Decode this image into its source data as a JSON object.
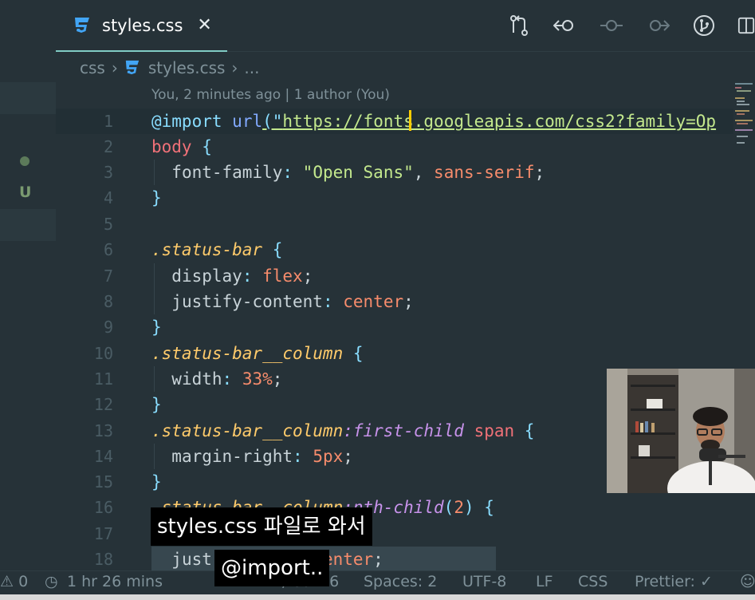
{
  "tab": {
    "title": "styles.css",
    "close": "✕"
  },
  "toolbar": {
    "icons": [
      "git-compare-icon",
      "go-back-icon",
      "commit-icon",
      "go-forward-icon",
      "source-control-icon",
      "split-editor-icon"
    ]
  },
  "breadcrumb": {
    "folder": "css",
    "file": "styles.css",
    "more": "..."
  },
  "blame": "You, 2 minutes ago | 1 author (You)",
  "sidebar": {
    "badge": "U"
  },
  "code_lines": [
    {
      "n": "1"
    },
    {
      "n": "2"
    },
    {
      "n": "3"
    },
    {
      "n": "4"
    },
    {
      "n": "5"
    },
    {
      "n": "6"
    },
    {
      "n": "7"
    },
    {
      "n": "8"
    },
    {
      "n": "9"
    },
    {
      "n": "10"
    },
    {
      "n": "11"
    },
    {
      "n": "12"
    },
    {
      "n": "13"
    },
    {
      "n": "14"
    },
    {
      "n": "15"
    },
    {
      "n": "16"
    },
    {
      "n": "17"
    },
    {
      "n": "18"
    }
  ],
  "code": {
    "l1": {
      "at": "@import",
      "fn": "url",
      "p1": "(\"",
      "url": "https://fonts.googleapis.com/css2?family=Op"
    },
    "l2": {
      "sel": "body",
      "brace": " {"
    },
    "l3": {
      "prop": "font-family",
      "colon": ": ",
      "v1": "\"Open Sans\"",
      "comma": ", ",
      "v2": "sans-serif",
      "semi": ";"
    },
    "l4": {
      "brace": "}"
    },
    "l6": {
      "sel": ".status-bar",
      "brace": " {"
    },
    "l7": {
      "prop": "display",
      "colon": ": ",
      "val": "flex",
      "semi": ";"
    },
    "l8": {
      "prop": "justify-content",
      "colon": ": ",
      "val": "center",
      "semi": ";"
    },
    "l9": {
      "brace": "}"
    },
    "l10": {
      "sel": ".status-bar__column",
      "brace": " {"
    },
    "l11": {
      "prop": "width",
      "colon": ": ",
      "val": "33%",
      "semi": ";"
    },
    "l12": {
      "brace": "}"
    },
    "l13": {
      "sel": ".status-bar__column",
      "pseudo": ":first-child",
      "tag": " span",
      "brace": " {"
    },
    "l14": {
      "prop": "margin-right",
      "colon": ": ",
      "val": "5px",
      "semi": ";"
    },
    "l15": {
      "brace": "}"
    },
    "l16": {
      "sel": ".status-bar__column",
      "pseudo": ":nth-child",
      "arg1": "(",
      "arg": "2",
      "arg2": ")",
      "brace": " {"
    },
    "l18": {
      "prop": "just",
      "val": "center",
      "semi": ";"
    }
  },
  "statusbar": {
    "problems": "⚠ 0",
    "time": "1 hr 26 mins",
    "position": "Ln 1, Col 26",
    "spaces": "Spaces: 2",
    "encoding": "UTF-8",
    "eol": "LF",
    "language": "CSS",
    "prettier": "Prettier: ✓"
  },
  "subtitles": {
    "line1": "styles.css 파일로 와서",
    "line2": "@import.."
  },
  "colors": {
    "background": "#263238",
    "accent": "#80cbc4",
    "string": "#c3e88d",
    "selector": "#ffcb6b",
    "cursor": "#ffcc00"
  }
}
